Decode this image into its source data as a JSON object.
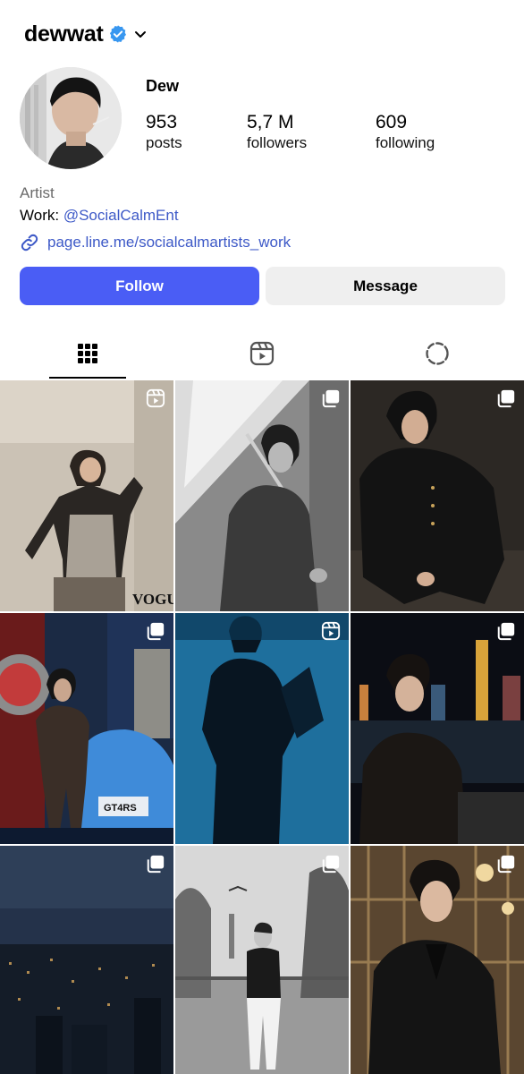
{
  "header": {
    "username": "dewwat",
    "verified_icon": "verified-badge-icon",
    "dropdown_icon": "chevron-down-icon"
  },
  "profile": {
    "display_name": "Dew",
    "stats": [
      {
        "value": "953",
        "label": "posts"
      },
      {
        "value": "5,7 M",
        "label": "followers"
      },
      {
        "value": "609",
        "label": "following"
      }
    ],
    "category": "Artist",
    "work_prefix": "Work: ",
    "work_mention": "@SocialCalmEnt",
    "link": "page.line.me/socialcalmartists_work"
  },
  "actions": {
    "follow": "Follow",
    "message": "Message"
  },
  "tabs": [
    {
      "name": "grid",
      "icon": "grid-icon",
      "active": true
    },
    {
      "name": "reels",
      "icon": "reels-icon",
      "active": false
    },
    {
      "name": "tagged",
      "icon": "dashed-circle-icon",
      "active": false
    }
  ],
  "colors": {
    "accent": "#4a5df5",
    "link": "#3d59c7",
    "secondary_button": "#efefef"
  },
  "grid": {
    "watermark": "VOGUE",
    "plate_text": "GT4RS",
    "posts": [
      {
        "badge": "reels-icon",
        "scene": "wall"
      },
      {
        "badge": "carousel-icon",
        "scene": "umbrella"
      },
      {
        "badge": "carousel-icon",
        "scene": "dark-studio"
      },
      {
        "badge": "carousel-icon",
        "scene": "car-showroom"
      },
      {
        "badge": "reels-icon",
        "scene": "blue-silhouette"
      },
      {
        "badge": "carousel-icon",
        "scene": "night-harbor"
      },
      {
        "badge": "carousel-icon",
        "scene": "city-night"
      },
      {
        "badge": "carousel-icon",
        "scene": "park"
      },
      {
        "badge": "carousel-icon",
        "scene": "gold-interior"
      }
    ]
  }
}
